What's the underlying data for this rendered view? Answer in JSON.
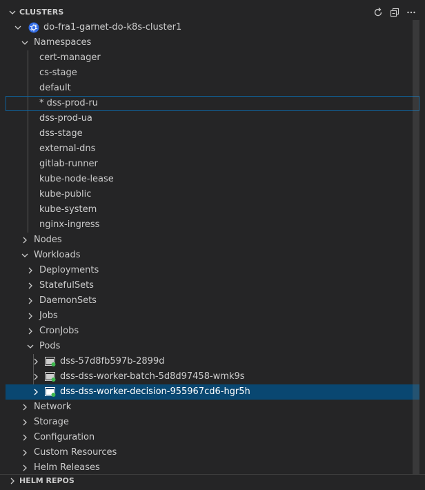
{
  "header": {
    "title": "CLUSTERS"
  },
  "cluster": {
    "label": "do-fra1-garnet-do-k8s-cluster1"
  },
  "namespaces": {
    "label": "Namespaces",
    "items": [
      "cert-manager",
      "cs-stage",
      "default",
      "* dss-prod-ru",
      "dss-prod-ua",
      "dss-stage",
      "external-dns",
      "gitlab-runner",
      "kube-node-lease",
      "kube-public",
      "kube-system",
      "nginx-ingress"
    ]
  },
  "nodes": {
    "label": "Nodes"
  },
  "workloads": {
    "label": "Workloads",
    "items": [
      "Deployments",
      "StatefulSets",
      "DaemonSets",
      "Jobs",
      "CronJobs"
    ],
    "pods": {
      "label": "Pods",
      "items": [
        "dss-57d8fb597b-2899d",
        "dss-dss-worker-batch-5d8d97458-wmk9s",
        "dss-dss-worker-decision-955967cd6-hgr5h"
      ]
    }
  },
  "groups": [
    "Network",
    "Storage",
    "Configuration",
    "Custom Resources",
    "Helm Releases"
  ],
  "helm": {
    "title": "HELM REPOS"
  },
  "colors": {
    "background": "#252526",
    "selection": "#094771",
    "focus_border": "#0e639c",
    "k8s_blue": "#326ce5",
    "status_green": "#3fb950"
  }
}
